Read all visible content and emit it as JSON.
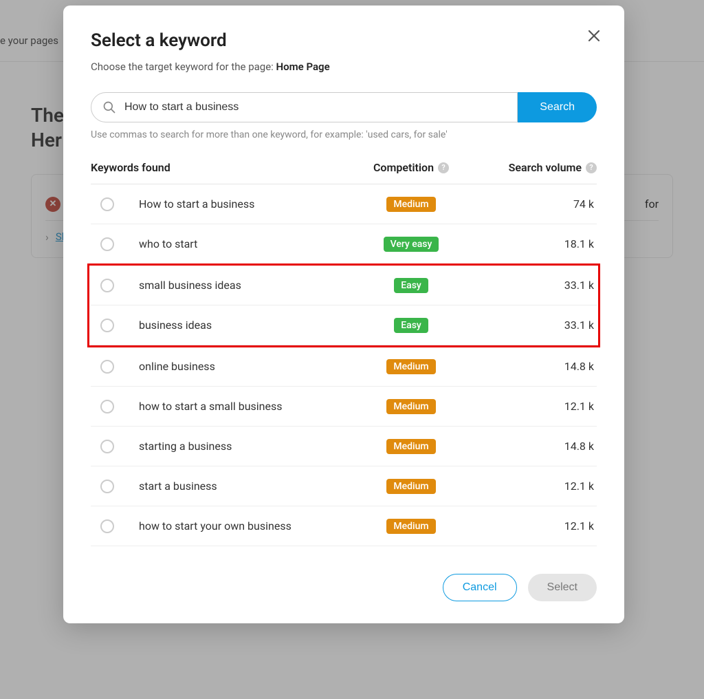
{
  "bg": {
    "header_text": "e your pages",
    "title_line1": "The",
    "title_line2": "Her",
    "card_text": "for",
    "expand_link": "Sh"
  },
  "modal": {
    "title": "Select a keyword",
    "subtitle_prefix": "Choose the target keyword for the page: ",
    "subtitle_page": "Home Page",
    "search_value": "How to start a business",
    "search_button": "Search",
    "search_hint": "Use commas to search for more than one keyword, for example: 'used cars, for sale'",
    "col_keyword": "Keywords found",
    "col_competition": "Competition",
    "col_volume": "Search volume",
    "cancel": "Cancel",
    "select": "Select"
  },
  "rows": [
    {
      "keyword": "How to start a business",
      "competition": "Medium",
      "comp_class": "badge-medium",
      "volume": "74 k"
    },
    {
      "keyword": "who to start",
      "competition": "Very easy",
      "comp_class": "badge-veryeasy",
      "volume": "18.1 k"
    },
    {
      "keyword": "small business ideas",
      "competition": "Easy",
      "comp_class": "badge-easy",
      "volume": "33.1 k"
    },
    {
      "keyword": "business ideas",
      "competition": "Easy",
      "comp_class": "badge-easy",
      "volume": "33.1 k"
    },
    {
      "keyword": "online business",
      "competition": "Medium",
      "comp_class": "badge-medium",
      "volume": "14.8 k"
    },
    {
      "keyword": "how to start a small business",
      "competition": "Medium",
      "comp_class": "badge-medium",
      "volume": "12.1 k"
    },
    {
      "keyword": "starting a business",
      "competition": "Medium",
      "comp_class": "badge-medium",
      "volume": "14.8 k"
    },
    {
      "keyword": "start a business",
      "competition": "Medium",
      "comp_class": "badge-medium",
      "volume": "12.1 k"
    },
    {
      "keyword": "how to start your own business",
      "competition": "Medium",
      "comp_class": "badge-medium",
      "volume": "12.1 k"
    }
  ],
  "highlight_range": [
    2,
    3
  ]
}
